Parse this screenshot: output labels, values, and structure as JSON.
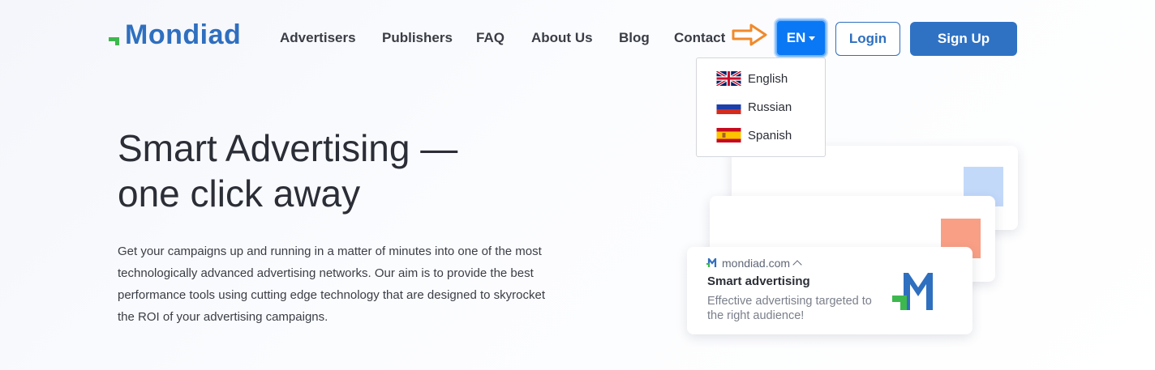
{
  "brand": {
    "name": "Mondiad",
    "accent": "#2f6fbf",
    "green": "#3db84e"
  },
  "nav": {
    "items": [
      "Advertisers",
      "Publishers",
      "FAQ",
      "About Us",
      "Blog",
      "Contact"
    ]
  },
  "header": {
    "language_current": "EN",
    "login_label": "Login",
    "signup_label": "Sign Up"
  },
  "language_menu": {
    "options": [
      {
        "label": "English",
        "icon": "uk-flag-icon"
      },
      {
        "label": "Russian",
        "icon": "russia-flag-icon"
      },
      {
        "label": "Spanish",
        "icon": "spain-flag-icon"
      }
    ]
  },
  "hero": {
    "title_line1": "Smart Advertising —",
    "title_line2": "one click away",
    "description": "Get your campaigns up and running in a matter of minutes into one of the most technologically advanced advertising networks. Our aim is to provide the best performance tools using cutting edge technology that are designed to skyrocket the ROI of your advertising campaigns."
  },
  "ad_preview": {
    "domain": "mondiad.com",
    "title": "Smart advertising",
    "subtitle": "Effective advertising targeted to the right audience!"
  }
}
